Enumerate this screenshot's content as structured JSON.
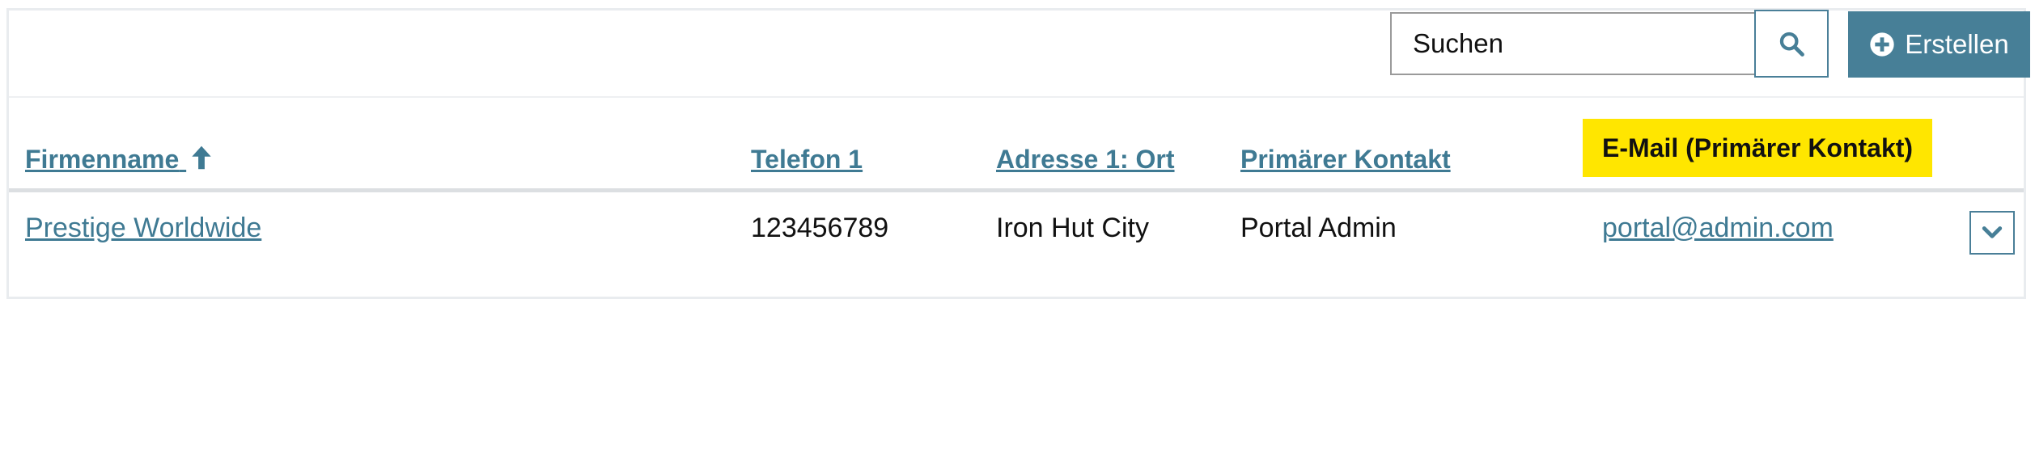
{
  "search": {
    "placeholder": "Suchen",
    "value": ""
  },
  "toolbar": {
    "create_label": "Erstellen"
  },
  "colors": {
    "accent": "#477f97",
    "link": "#3f7a93",
    "highlight": "#ffe600"
  },
  "table": {
    "columns": [
      {
        "label": "Firmenname",
        "sort": "ascending"
      },
      {
        "label": "Telefon 1"
      },
      {
        "label": "Adresse 1: Ort"
      },
      {
        "label": "Primärer Kontakt"
      },
      {
        "label": "E-Mail (Primärer Kontakt)",
        "highlighted": true
      }
    ],
    "rows": [
      {
        "firmenname": "Prestige Worldwide",
        "telefon": "123456789",
        "ort": "Iron Hut City",
        "kontakt": "Portal Admin",
        "email": "portal@admin.com"
      }
    ]
  },
  "icons": {
    "search": "search-icon",
    "create": "plus-circle-icon",
    "sort": "arrow-up-icon",
    "row_menu": "chevron-down-icon"
  }
}
